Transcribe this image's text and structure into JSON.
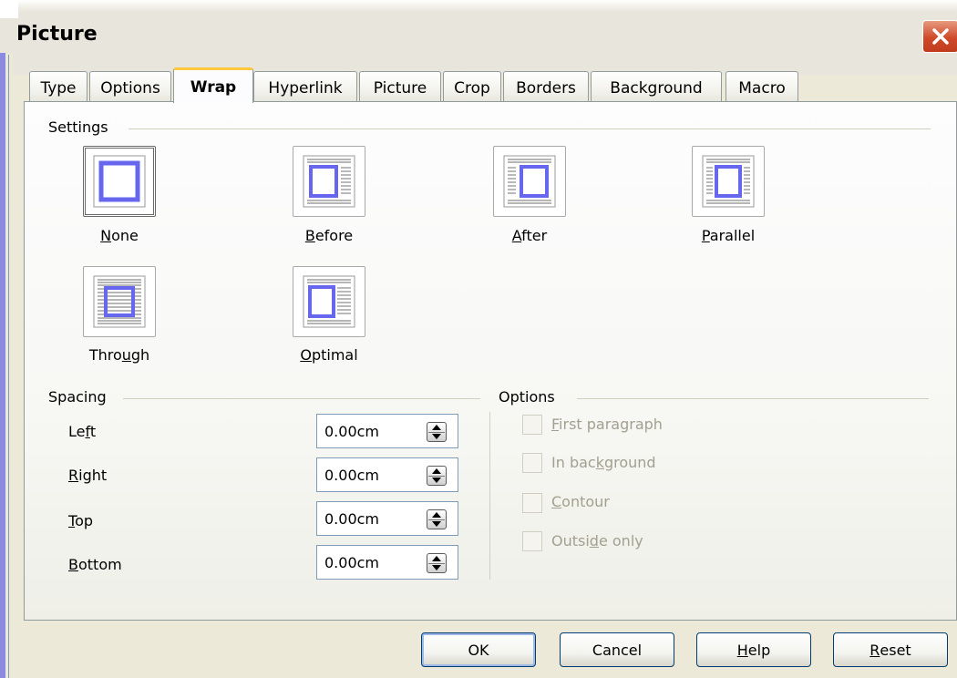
{
  "window": {
    "title": "Picture"
  },
  "tabs": [
    {
      "label": "Type"
    },
    {
      "label": "Options"
    },
    {
      "label": "Wrap"
    },
    {
      "label": "Hyperlink"
    },
    {
      "label": "Picture"
    },
    {
      "label": "Crop"
    },
    {
      "label": "Borders"
    },
    {
      "label": "Background"
    },
    {
      "label": "Macro"
    }
  ],
  "active_tab": "Wrap",
  "settings": {
    "title": "Settings",
    "items": [
      {
        "label": "None",
        "mnemonic": "N",
        "rest": "one",
        "icon": "wrap-none-icon",
        "selected": true
      },
      {
        "label": "Before",
        "mnemonic": "B",
        "rest": "efore",
        "icon": "wrap-before-icon",
        "selected": false
      },
      {
        "label": "After",
        "mnemonic": "A",
        "rest": "fter",
        "icon": "wrap-after-icon",
        "selected": false
      },
      {
        "label": "Parallel",
        "mnemonic": "P",
        "rest": "arallel",
        "icon": "wrap-parallel-icon",
        "selected": false
      },
      {
        "label": "Through",
        "pre": "Thro",
        "mnemonic": "u",
        "rest": "gh",
        "icon": "wrap-through-icon",
        "selected": false
      },
      {
        "label": "Optimal",
        "mnemonic": "O",
        "rest": "ptimal",
        "icon": "wrap-optimal-icon",
        "selected": false
      }
    ]
  },
  "spacing": {
    "title": "Spacing",
    "fields": [
      {
        "label": "Left",
        "pre": "Le",
        "mnemonic": "f",
        "rest": "t",
        "value": "0.00cm"
      },
      {
        "label": "Right",
        "pre": "",
        "mnemonic": "R",
        "rest": "ight",
        "value": "0.00cm"
      },
      {
        "label": "Top",
        "pre": "",
        "mnemonic": "T",
        "rest": "op",
        "value": "0.00cm"
      },
      {
        "label": "Bottom",
        "pre": "",
        "mnemonic": "B",
        "rest": "ottom",
        "value": "0.00cm"
      }
    ]
  },
  "options": {
    "title": "Options",
    "items": [
      {
        "label": "First paragraph",
        "pre": "",
        "mnemonic": "F",
        "rest": "irst paragraph",
        "checked": false,
        "enabled": false
      },
      {
        "label": "In background",
        "pre": "In bac",
        "mnemonic": "k",
        "rest": "ground",
        "checked": false,
        "enabled": false
      },
      {
        "label": "Contour",
        "pre": "",
        "mnemonic": "C",
        "rest": "ontour",
        "checked": false,
        "enabled": false
      },
      {
        "label": "Outside only",
        "pre": "Outsi",
        "mnemonic": "d",
        "rest": "e only",
        "checked": false,
        "enabled": false
      }
    ]
  },
  "buttons": {
    "ok": "OK",
    "cancel": "Cancel",
    "help_mnemonic": "H",
    "help_rest": "elp",
    "reset_mnemonic": "R",
    "reset_rest": "eset"
  },
  "colors": {
    "icon_blue": "#6666ee",
    "tab_highlight": "#ffc73c",
    "close_red": "#cf4a2a"
  }
}
